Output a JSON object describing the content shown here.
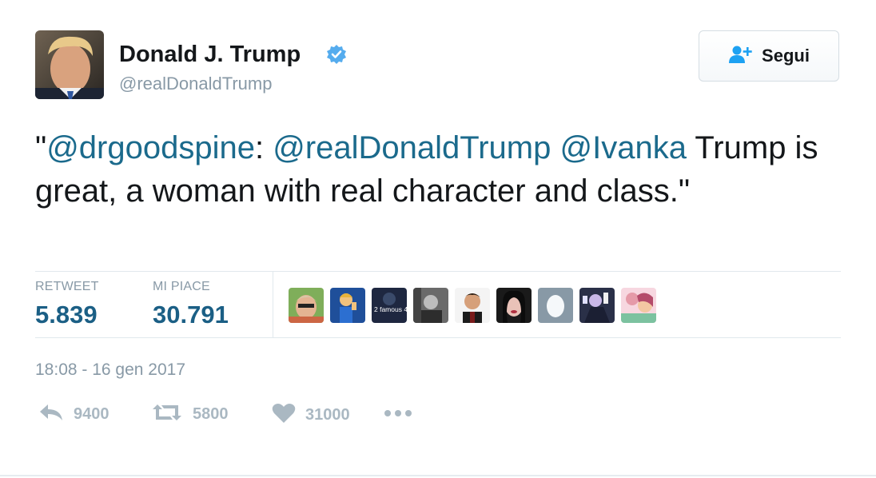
{
  "user": {
    "name": "Donald J. Trump",
    "handle": "@realDonaldTrump",
    "verified_icon": "verified-badge-icon"
  },
  "follow_button": {
    "label": "Segui",
    "icon": "add-user-icon"
  },
  "tweet": {
    "open_quote": "\"",
    "mention_1": "@drgoodspine",
    "colon": ": ",
    "mention_2": "@realDonaldTrump",
    "space": " ",
    "mention_3": "@Ivanka",
    "body": " Trump is great, a woman with real character and class.\""
  },
  "stats": {
    "retweets_label": "RETWEET",
    "retweets_value": "5.839",
    "likes_label": "MI PIACE",
    "likes_value": "30.791"
  },
  "likers": [
    {
      "text": ""
    },
    {
      "text": ""
    },
    {
      "text": "2 famous 4 u"
    },
    {
      "text": ""
    },
    {
      "text": ""
    },
    {
      "text": ""
    },
    {
      "text": ""
    },
    {
      "text": ""
    },
    {
      "text": ""
    }
  ],
  "timestamp": "18:08 - 16 gen 2017",
  "actions": {
    "reply_count": "9400",
    "retweet_count": "5800",
    "like_count": "31000",
    "reply_icon": "reply-icon",
    "retweet_icon": "retweet-icon",
    "like_icon": "heart-icon",
    "more_icon": "more-dots-icon"
  },
  "colors": {
    "link": "#1b6a8c",
    "stat_value": "#1b5f85",
    "muted": "#8899a6",
    "verified": "#55acee"
  }
}
